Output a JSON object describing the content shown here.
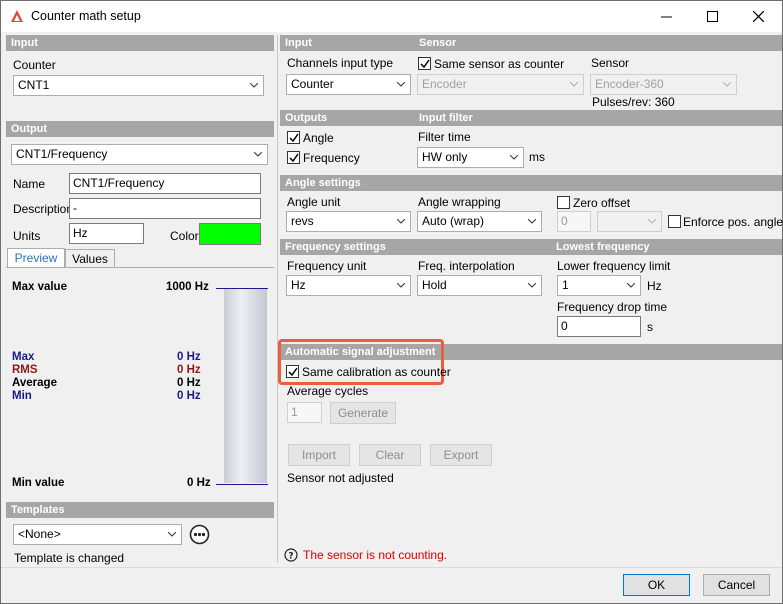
{
  "window": {
    "title": "Counter math setup",
    "minimize_icon": "minimize-icon",
    "maximize_icon": "maximize-icon",
    "close_icon": "close-icon"
  },
  "input": {
    "header": "Input",
    "counter_label": "Counter",
    "counter_value": "CNT1"
  },
  "output": {
    "header": "Output",
    "channel_value": "CNT1/Frequency",
    "name_label": "Name",
    "name_value": "CNT1/Frequency",
    "description_label": "Description",
    "description_value": "-",
    "units_label": "Units",
    "units_value": "Hz",
    "color_label": "Color",
    "color_value": "#00ff00"
  },
  "tabs": [
    {
      "label": "Preview",
      "active": true
    },
    {
      "label": "Values",
      "active": false
    }
  ],
  "preview": {
    "max_value_label": "Max value",
    "max_value": "1000 Hz",
    "min_value_label": "Min value",
    "min_value": "0 Hz",
    "stats": [
      {
        "label": "Max",
        "value": "0 Hz",
        "color": "#1a1a8c"
      },
      {
        "label": "RMS",
        "value": "0 Hz",
        "color": "#8b1a1a"
      },
      {
        "label": "Average",
        "value": "0 Hz",
        "color": "#000000"
      },
      {
        "label": "Min",
        "value": "0 Hz",
        "color": "#1a1a8c"
      }
    ]
  },
  "templates": {
    "header": "Templates",
    "value": "<None>",
    "status": "Template is changed",
    "more_icon": "more-options-icon"
  },
  "right_input": {
    "header": "Input",
    "channels_type_label": "Channels input type",
    "channels_type_value": "Counter"
  },
  "sensor": {
    "header": "Sensor",
    "same_sensor_label": "Same sensor as counter",
    "same_sensor_checked": true,
    "type_value": "Encoder",
    "sensor_label": "Sensor",
    "sensor_value": "Encoder-360",
    "pulses": "Pulses/rev: 360"
  },
  "outputs": {
    "header": "Outputs",
    "angle_label": "Angle",
    "angle_checked": true,
    "frequency_label": "Frequency",
    "frequency_checked": true
  },
  "input_filter": {
    "header": "Input filter",
    "filter_time_label": "Filter time",
    "filter_time_value": "HW only",
    "unit": "ms"
  },
  "angle_settings": {
    "header": "Angle settings",
    "unit_label": "Angle unit",
    "unit_value": "revs",
    "wrapping_label": "Angle wrapping",
    "wrapping_value": "Auto (wrap)",
    "zero_offset_label": "Zero offset",
    "zero_offset_checked": false,
    "zero_offset_value": "0",
    "enforce_label": "Enforce pos. angle",
    "enforce_checked": false
  },
  "frequency_settings": {
    "header": "Frequency settings",
    "unit_label": "Frequency unit",
    "unit_value": "Hz",
    "interp_label": "Freq. interpolation",
    "interp_value": "Hold"
  },
  "lowest_frequency": {
    "header": "Lowest frequency",
    "limit_label": "Lower frequency limit",
    "limit_value": "1",
    "limit_unit": "Hz",
    "drop_label": "Frequency drop time",
    "drop_value": "0",
    "drop_unit": "s"
  },
  "auto_adjust": {
    "header": "Automatic signal adjustment",
    "same_calib_label": "Same calibration as counter",
    "same_calib_checked": true,
    "avg_cycles_label": "Average cycles",
    "avg_cycles_value": "1",
    "generate_label": "Generate",
    "import_label": "Import",
    "clear_label": "Clear",
    "export_label": "Export",
    "status": "Sensor not adjusted"
  },
  "warning": {
    "text": "The sensor is not counting.",
    "icon": "question-icon",
    "color": "#e00000"
  },
  "footer": {
    "ok_label": "OK",
    "cancel_label": "Cancel"
  }
}
